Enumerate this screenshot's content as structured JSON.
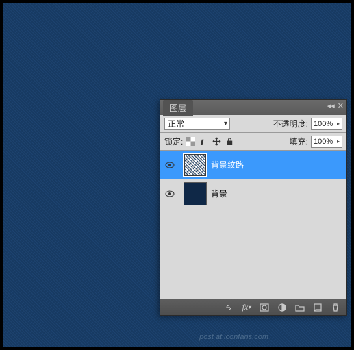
{
  "panel": {
    "title": "图层",
    "blend_row": {
      "mode": "正常",
      "opacity_label": "不透明度:",
      "opacity_value": "100%"
    },
    "lock_row": {
      "lock_label": "锁定:",
      "fill_label": "填充:",
      "fill_value": "100%"
    },
    "layers": [
      {
        "name": "背景纹路",
        "selected": true,
        "thumb": "checker"
      },
      {
        "name": "背景",
        "selected": false,
        "thumb": "solid"
      }
    ]
  },
  "watermark": "post at iconfans.com"
}
